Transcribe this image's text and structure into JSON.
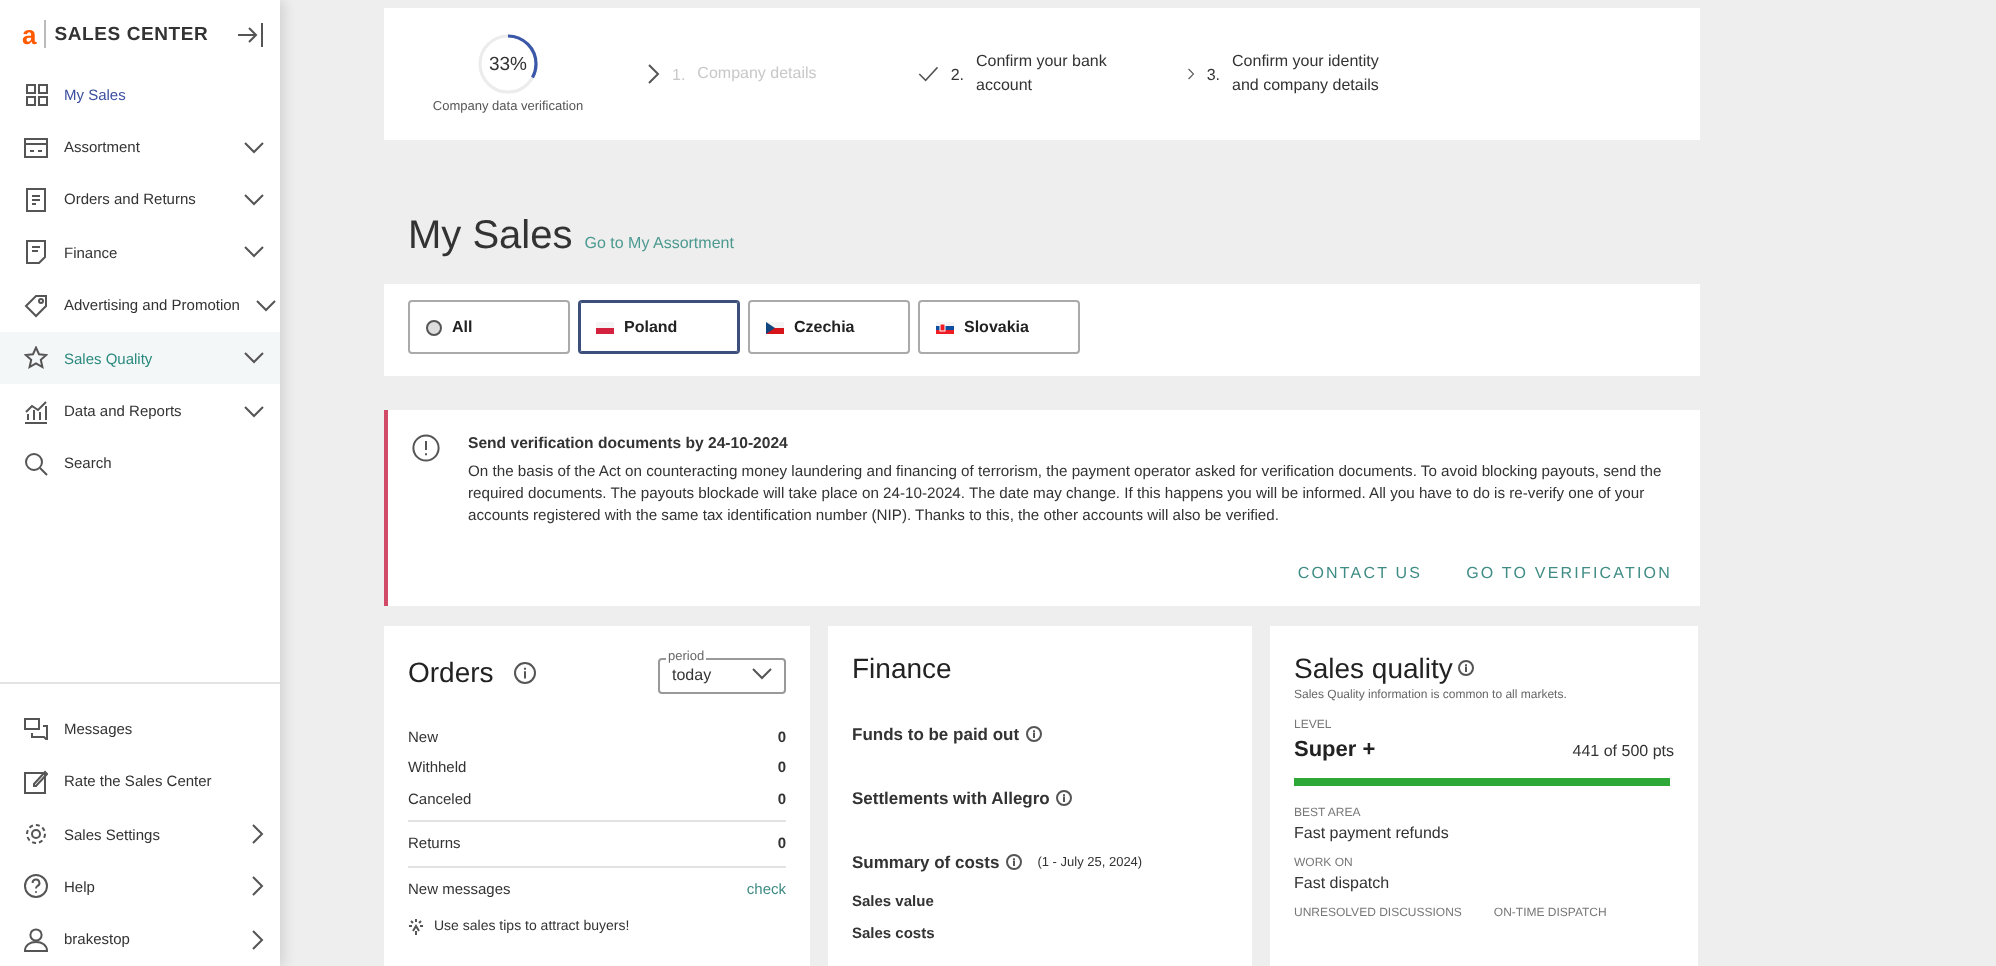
{
  "sidebar": {
    "logo": {
      "mark": "a",
      "text": "SALES CENTER"
    },
    "items": [
      {
        "label": "My Sales",
        "selected": true,
        "highlighted": false
      },
      {
        "label": "Assortment",
        "selected": false,
        "highlighted": false,
        "expandable": true
      },
      {
        "label": "Orders and Returns",
        "selected": false,
        "highlighted": false,
        "expandable": true
      },
      {
        "label": "Finance",
        "selected": false,
        "highlighted": false,
        "expandable": true
      },
      {
        "label": "Advertising and Promotion",
        "selected": false,
        "highlighted": false,
        "expandable": true
      },
      {
        "label": "Sales Quality",
        "selected": false,
        "highlighted": true,
        "expandable": true
      },
      {
        "label": "Data and Reports",
        "selected": false,
        "highlighted": false,
        "expandable": true
      },
      {
        "label": "Search",
        "selected": false,
        "highlighted": false
      }
    ],
    "bottom_items": [
      {
        "label": "Messages",
        "selected": false,
        "highlighted": false
      },
      {
        "label": "Rate the Sales Center",
        "selected": false,
        "highlighted": false
      },
      {
        "label": "Sales Settings",
        "selected": false,
        "highlighted": false,
        "expandable": true
      },
      {
        "label": "Help",
        "selected": false,
        "highlighted": false,
        "expandable": true
      },
      {
        "label": "brakestop",
        "selected": false,
        "highlighted": false,
        "expandable": true
      }
    ]
  },
  "verification": {
    "percent": "33%",
    "level": 0.33,
    "caption": "Company data verification",
    "steps": [
      {
        "number": "1.",
        "label": "Company details",
        "disabled": true,
        "done": false
      },
      {
        "number": "2.",
        "label": "Confirm your bank account",
        "disabled": false,
        "done": true
      },
      {
        "number": "3.",
        "label": "Confirm your identity and company details",
        "disabled": false,
        "done": false
      }
    ]
  },
  "page": {
    "title": "My Sales",
    "link": "Go to My Assortment"
  },
  "markets": [
    {
      "label": "All",
      "kind": "globe",
      "selected": false
    },
    {
      "label": "Poland",
      "kind": "pl",
      "selected": true
    },
    {
      "label": "Czechia",
      "kind": "cz",
      "selected": false
    },
    {
      "label": "Slovakia",
      "kind": "sk",
      "selected": false
    }
  ],
  "alert": {
    "title": "Send verification documents by 24-10-2024",
    "body": "On the basis of the Act on counteracting money laundering and financing of terrorism, the payment operator asked for verification documents. To avoid blocking payouts, send the required documents. The payouts blockade will take place on 24-10-2024. The date may change. If this happens you will be informed. All you have to do is re-verify one of your accounts registered with the same tax identification number (NIP). Thanks to this, the other accounts will also be verified.",
    "actions": [
      "CONTACT US",
      "GO TO VERIFICATION"
    ]
  },
  "orders": {
    "title": "Orders",
    "period": {
      "label": "period",
      "value": "today"
    },
    "groups": [
      [
        {
          "label": "New",
          "value": "0",
          "kind": "count"
        },
        {
          "label": "Withheld",
          "value": "0",
          "kind": "count"
        },
        {
          "label": "Canceled",
          "value": "0",
          "kind": "count"
        }
      ],
      [
        {
          "label": "Returns",
          "value": "0",
          "kind": "count"
        }
      ],
      [
        {
          "label": "New messages",
          "value": "check",
          "kind": "link"
        }
      ]
    ],
    "tip": "Use sales tips to attract buyers!"
  },
  "finance": {
    "title": "Finance",
    "sections": [
      {
        "label": "Funds to be paid out"
      },
      {
        "label": "Settlements with Allegro"
      },
      {
        "label": "Summary of costs",
        "note": "(1 - July 25, 2024)"
      }
    ],
    "rows": [
      "Sales value",
      "Sales costs"
    ]
  },
  "quality": {
    "title": "Sales quality",
    "note": "Sales Quality information is common to all markets.",
    "level_label": "LEVEL",
    "level_name": "Super +",
    "points": "441 of 500 pts",
    "level": 1,
    "facts": [
      {
        "label": "BEST AREA",
        "value": "Fast payment refunds"
      },
      {
        "label": "WORK ON",
        "value": "Fast dispatch"
      }
    ],
    "columns": [
      "UNRESOLVED DISCUSSIONS",
      "ON-TIME DISPATCH"
    ]
  }
}
